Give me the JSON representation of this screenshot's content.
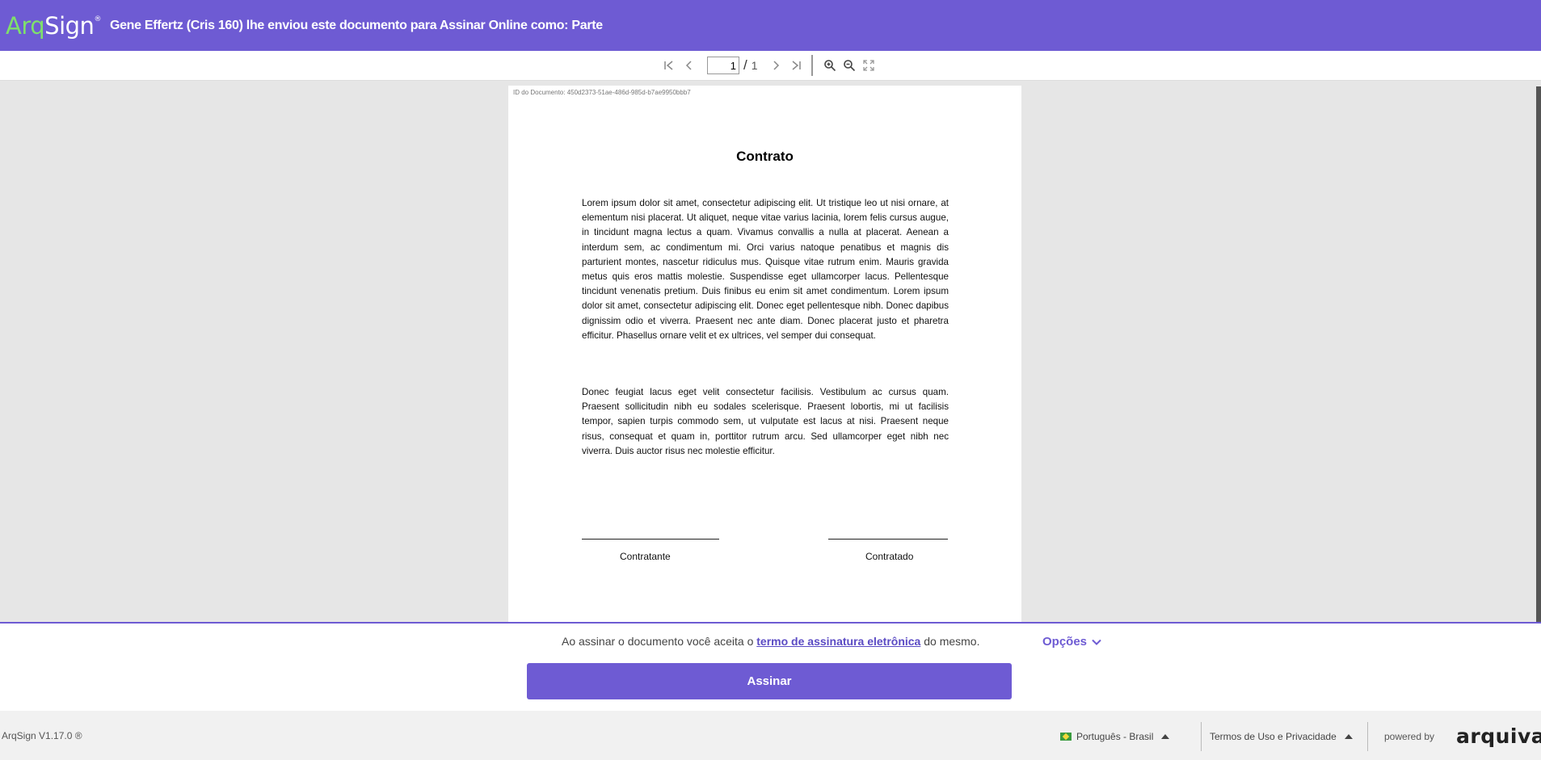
{
  "header": {
    "logo_arq": "Arq",
    "logo_sign": "Sign",
    "logo_reg": "®",
    "title": "Gene Effertz (Cris 160) lhe enviou este documento para Assinar Online como: Parte"
  },
  "toolbar": {
    "page_current": "1",
    "slash": "/",
    "page_total": "1",
    "icons": [
      "first-page-icon",
      "prev-page-icon",
      "next-page-icon",
      "last-page-icon",
      "zoom-in-icon",
      "zoom-out-icon",
      "fullscreen-icon"
    ]
  },
  "document": {
    "id_label": "ID do Documento: 450d2373-51ae-486d-985d-b7ae9950bbb7",
    "title": "Contrato",
    "paragraph1": "Lorem ipsum dolor sit amet, consectetur adipiscing elit. Ut tristique leo ut nisi ornare, at elementum nisi placerat. Ut aliquet, neque vitae varius lacinia, lorem felis cursus augue, in tincidunt magna lectus a quam. Vivamus convallis a nulla at placerat. Aenean a interdum sem, ac condimentum mi. Orci varius natoque penatibus et magnis dis parturient montes, nascetur ridiculus mus. Quisque vitae rutrum enim. Mauris gravida metus quis eros mattis molestie. Suspendisse eget ullamcorper lacus. Pellentesque tincidunt venenatis pretium. Duis finibus eu enim sit amet condimentum. Lorem ipsum dolor sit amet, consectetur adipiscing elit. Donec eget pellentesque nibh. Donec dapibus dignissim odio et viverra. Praesent nec ante diam. Donec placerat justo et pharetra efficitur. Phasellus ornare velit et ex ultrices, vel semper dui consequat.",
    "paragraph2": "Donec feugiat lacus eget velit consectetur facilisis. Vestibulum ac cursus quam. Praesent sollicitudin nibh eu sodales scelerisque. Praesent lobortis, mi ut facilisis tempor, sapien turpis commodo sem, ut vulputate est lacus at nisi. Praesent neque risus, consequat et quam in, porttitor rutrum arcu. Sed ullamcorper eget nibh nec viverra. Duis auctor risus nec molestie efficitur.",
    "signature_left": "Contratante",
    "signature_right": "Contratado"
  },
  "actions": {
    "accept_prefix": "Ao assinar o documento você aceita o ",
    "accept_link": "termo de assinatura eletrônica",
    "accept_suffix": " do mesmo.",
    "options_label": "Opções",
    "sign_button": "Assinar"
  },
  "footer": {
    "version": "ArqSign V1.17.0 ®",
    "language": "Português - Brasil",
    "terms": "Termos de Uso e Privacidade",
    "powered_by": "powered by",
    "brand": "arquivar"
  },
  "colors": {
    "primary": "#6e5bd3",
    "logo_accent": "#7fe06b",
    "viewer_bg": "#e6e6e6"
  }
}
